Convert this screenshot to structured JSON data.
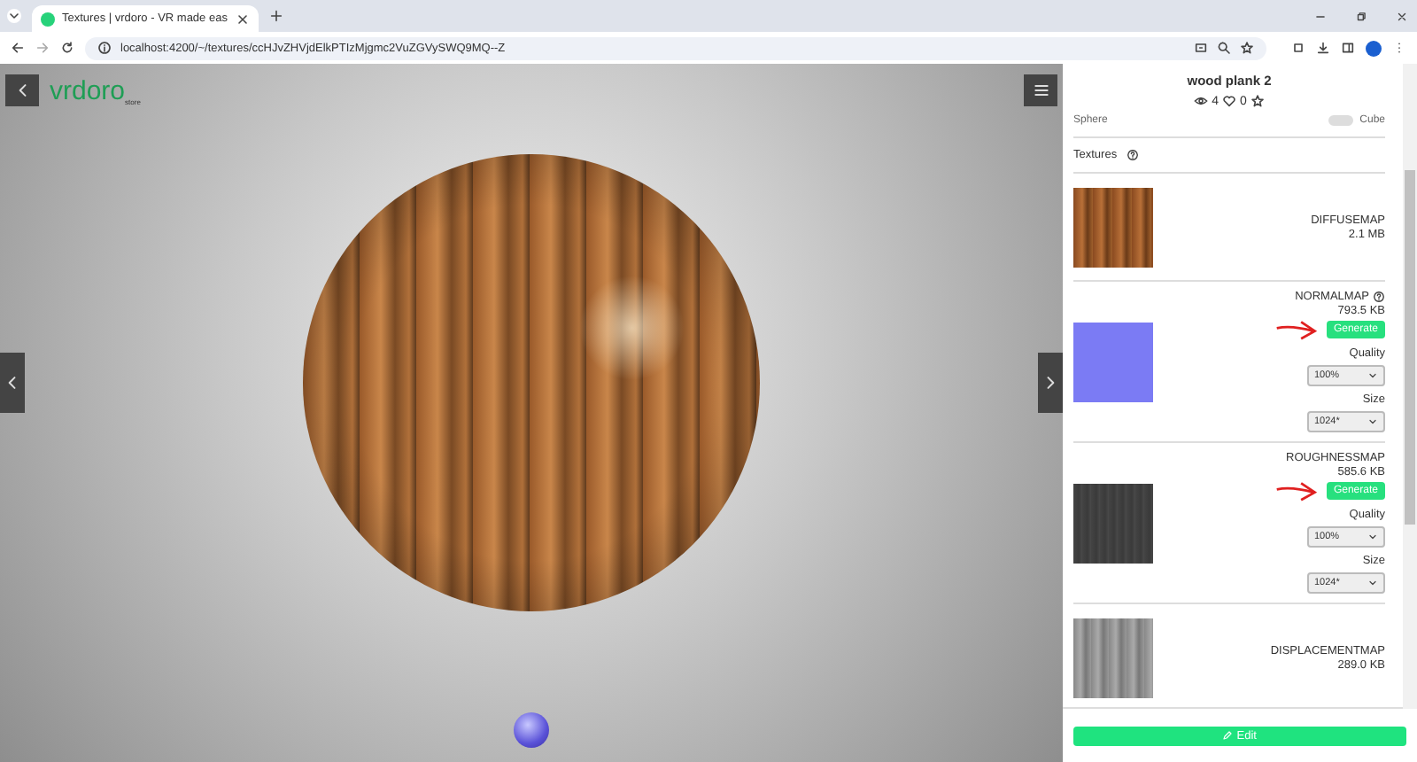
{
  "browser": {
    "tab_title": "Textures | vrdoro - VR made eas",
    "url": "localhost:4200/~/textures/ccHJvZHVjdElkPTIzMjgmc2VuZGVySWQ9MQ--Z"
  },
  "viewer": {
    "logo": "vrdoro",
    "logo_sub": "store"
  },
  "panel": {
    "title": "wood plank 2",
    "views": "4",
    "likes": "0",
    "shape_left": "Sphere",
    "shape_right": "Cube",
    "shape_toggle_on": false,
    "textures_label": "Textures",
    "textures": [
      {
        "kind": "plain",
        "name": "DIFFUSEMAP",
        "size": "2.1 MB",
        "help": false
      },
      {
        "kind": "generate",
        "name": "NORMALMAP",
        "size": "793.5 KB",
        "help": true,
        "button": "Generate",
        "quality_label": "Quality",
        "quality": "100%",
        "size_label": "Size",
        "resolution": "1024*"
      },
      {
        "kind": "generate",
        "name": "ROUGHNESSMAP",
        "size": "585.6 KB",
        "help": false,
        "button": "Generate",
        "quality_label": "Quality",
        "quality": "100%",
        "size_label": "Size",
        "resolution": "1024*"
      },
      {
        "kind": "plain",
        "name": "DISPLACEMENTMAP",
        "size": "289.0 KB",
        "help": false
      }
    ],
    "edit_button": "Edit"
  }
}
